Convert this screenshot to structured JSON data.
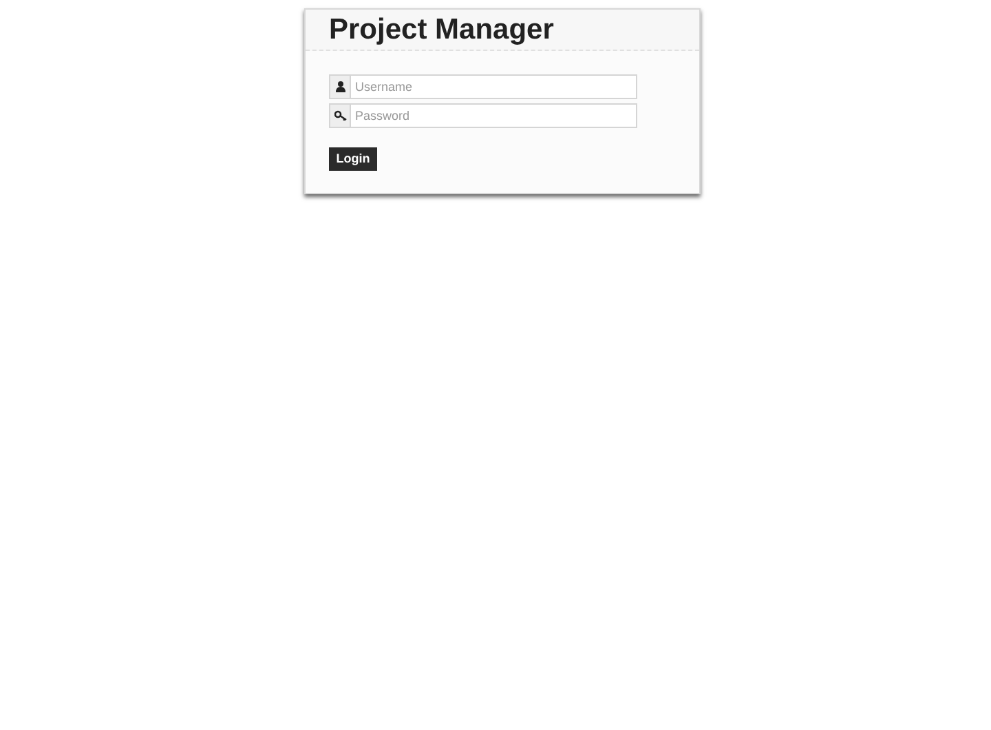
{
  "title": "Project Manager",
  "fields": [
    {
      "kind": "user",
      "placeholder": "Username"
    },
    {
      "kind": "key",
      "placeholder": "Password"
    }
  ],
  "button": "Login"
}
